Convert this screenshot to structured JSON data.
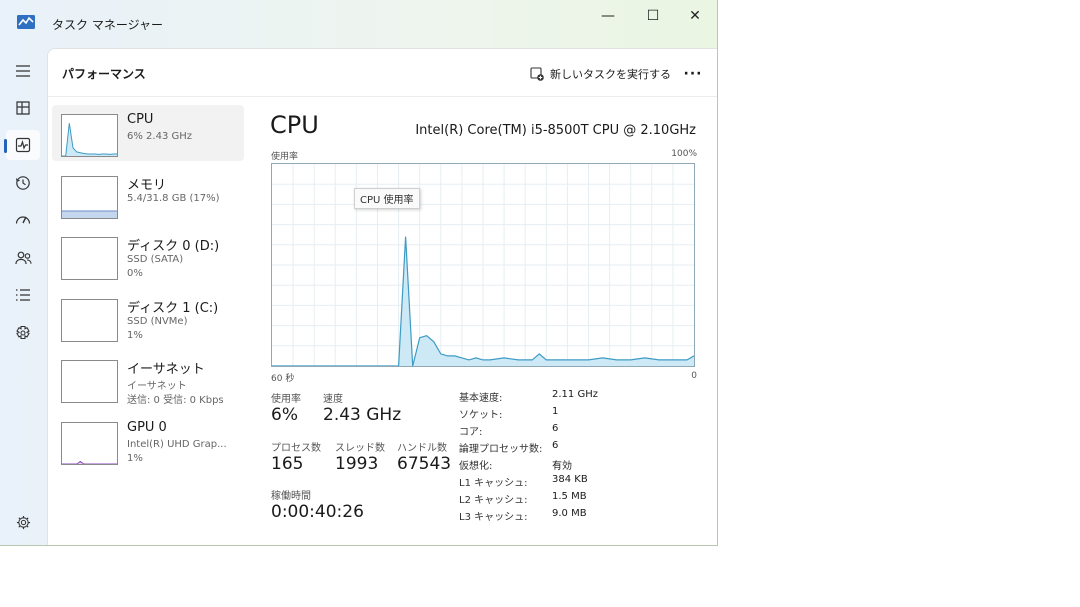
{
  "window": {
    "title": "タスク マネージャー",
    "minimize": "—",
    "maximize": "☐",
    "close": "✕"
  },
  "nav": {
    "items": [
      {
        "icon": "hamburger-icon"
      },
      {
        "icon": "processes-icon"
      },
      {
        "icon": "performance-icon",
        "active": true
      },
      {
        "icon": "app-history-icon"
      },
      {
        "icon": "startup-icon"
      },
      {
        "icon": "users-icon"
      },
      {
        "icon": "details-icon"
      },
      {
        "icon": "services-icon"
      },
      {
        "icon": "settings-icon"
      }
    ]
  },
  "header": {
    "title": "パフォーマンス",
    "new_task_label": "新しいタスクを実行する",
    "more_label": "···"
  },
  "devices": [
    {
      "name": "CPU",
      "sub1": "6%  2.43 GHz",
      "sub2": "",
      "selected": true
    },
    {
      "name": "メモリ",
      "sub1": "5.4/31.8 GB (17%)",
      "sub2": ""
    },
    {
      "name": "ディスク 0 (D:)",
      "sub1": "SSD (SATA)",
      "sub2": "0%"
    },
    {
      "name": "ディスク 1 (C:)",
      "sub1": "SSD (NVMe)",
      "sub2": "1%"
    },
    {
      "name": "イーサネット",
      "sub1": "イーサネット",
      "sub2": "送信: 0 受信: 0 Kbps"
    },
    {
      "name": "GPU 0",
      "sub1": "Intel(R) UHD Grap...",
      "sub2": "1%"
    }
  ],
  "cpu": {
    "heading": "CPU",
    "model": "Intel(R) Core(TM) i5-8500T CPU @ 2.10GHz",
    "usage_label": "使用率",
    "usage_max": "100%",
    "tooltip": "CPU 使用率",
    "axis_left": "60 秒",
    "axis_right": "0",
    "stats": {
      "usage_label": "使用率",
      "usage_value": "6%",
      "speed_label": "速度",
      "speed_value": "2.43 GHz",
      "processes_label": "プロセス数",
      "processes_value": "165",
      "threads_label": "スレッド数",
      "threads_value": "1993",
      "handles_label": "ハンドル数",
      "handles_value": "67543",
      "uptime_label": "稼働時間",
      "uptime_value": "0:00:40:26"
    },
    "specs": [
      {
        "label": "基本速度:",
        "value": "2.11 GHz"
      },
      {
        "label": "ソケット:",
        "value": "1"
      },
      {
        "label": "コア:",
        "value": "6"
      },
      {
        "label": "論理プロセッサ数:",
        "value": "6"
      },
      {
        "label": "仮想化:",
        "value": "有効"
      },
      {
        "label": "L1 キャッシュ:",
        "value": "384 KB"
      },
      {
        "label": "L2 キャッシュ:",
        "value": "1.5 MB"
      },
      {
        "label": "L3 キャッシュ:",
        "value": "9.0 MB"
      }
    ]
  },
  "chart_data": {
    "type": "area",
    "x": [
      60,
      57,
      54,
      51,
      48,
      45,
      42,
      41,
      40,
      39,
      38,
      37,
      36,
      35,
      34,
      33,
      32,
      31,
      30,
      29,
      27,
      25,
      23,
      22,
      21,
      19,
      17,
      15,
      13,
      11,
      9,
      7,
      5,
      3,
      1,
      0
    ],
    "values": [
      0,
      0,
      0,
      0,
      0,
      0,
      0,
      64,
      0,
      14,
      15,
      12,
      6,
      5,
      5,
      4,
      3,
      4,
      3,
      3,
      4,
      3,
      3,
      6,
      3,
      3,
      3,
      3,
      4,
      3,
      3,
      4,
      3,
      3,
      3,
      5
    ],
    "xlim": [
      60,
      0
    ],
    "ylim": [
      0,
      100
    ],
    "grid": true,
    "colors": {
      "line": "#3d9bc5",
      "fill": "#cce9f5"
    }
  },
  "thumbs": {
    "cpu": {
      "values": [
        0,
        0,
        80,
        20,
        10,
        8,
        6,
        5,
        5,
        5,
        4,
        5,
        5,
        4,
        5,
        5
      ],
      "color": "#3d9bc5",
      "fill": "#cce9f5"
    },
    "memory": {
      "values": [
        17,
        17,
        17,
        17,
        17,
        17,
        17,
        17,
        17,
        17,
        17,
        17,
        17,
        17,
        17,
        17
      ],
      "color": "#6b8ec7",
      "fill": "#c5d6ef"
    },
    "gpu": {
      "values": [
        0,
        0,
        0,
        0,
        0,
        6,
        0,
        0,
        0,
        0,
        0,
        0,
        0,
        0,
        0,
        0
      ],
      "color": "#8c4dc2",
      "fill": "#e4d2f2"
    }
  }
}
